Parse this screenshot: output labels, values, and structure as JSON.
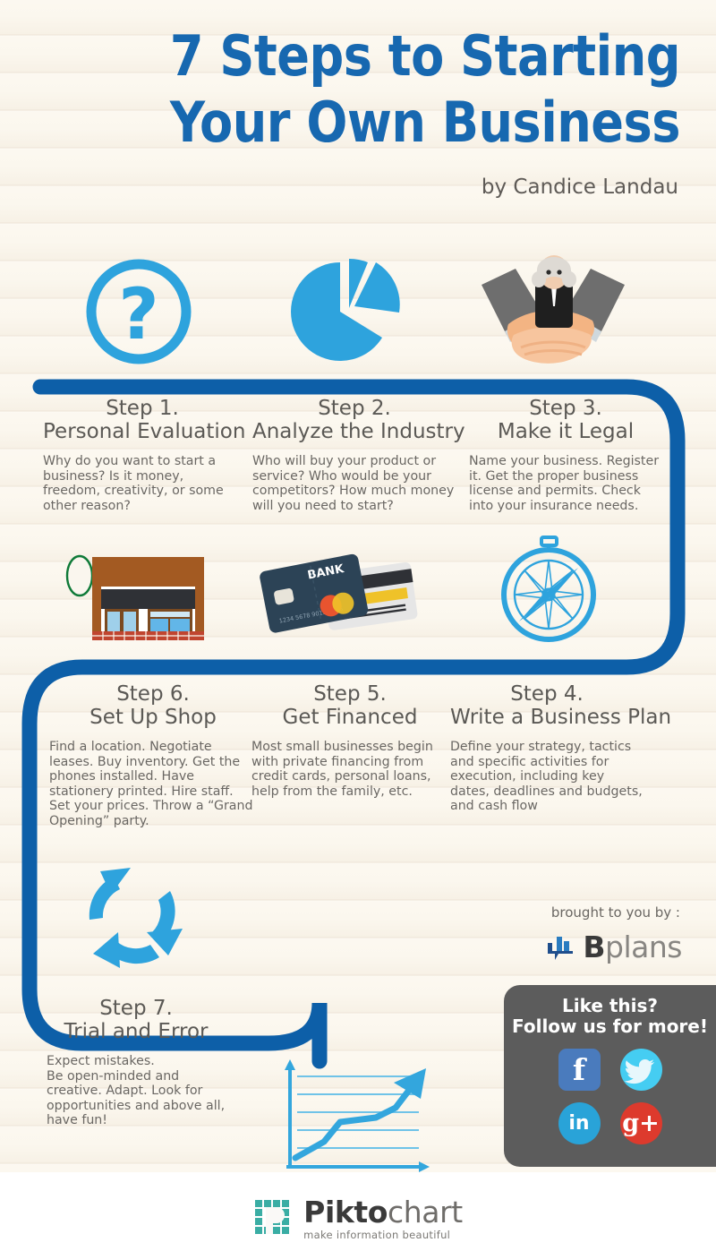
{
  "header": {
    "title_line1": "7 Steps to Starting",
    "title_line2": "Your Own Business",
    "byline": "by Candice Landau",
    "title_color": "#1768b0"
  },
  "theme": {
    "background": "#faf6ee",
    "ribbon_color": "#0d5fa8",
    "icon_blue": "#2ea3dd",
    "heading_gray": "#5b5955",
    "body_gray": "#6a6763"
  },
  "steps": [
    {
      "number": "Step 1.",
      "title": "Personal Evaluation",
      "body": "Why do you want to start a business? Is it money, freedom, creativity, or some other reason?",
      "icon": "question-mark-circle-icon"
    },
    {
      "number": "Step 2.",
      "title": "Analyze the Industry",
      "body": "Who will buy your product or service? Who would be your competitors? How much money will you need to start?",
      "icon": "pie-chart-icon"
    },
    {
      "number": "Step 3.",
      "title": "Make it Legal",
      "body": "Name your business. Register it. Get the proper business license and permits. Check into your insurance needs.",
      "icon": "judge-handshake-icon"
    },
    {
      "number": "Step 4.",
      "title": "Write a Business Plan",
      "body": "Define your strategy, tactics and specific activities for execution, including key dates, deadlines and budgets, and cash flow",
      "icon": "compass-icon"
    },
    {
      "number": "Step 5.",
      "title": "Get Financed",
      "body": "Most small businesses begin with private financing from credit cards, personal loans, help from the family, etc.",
      "icon": "credit-cards-icon"
    },
    {
      "number": "Step 6.",
      "title": "Set Up Shop",
      "body": "Find a location. Negotiate leases. Buy inventory. Get the phones installed. Have stationery printed. Hire staff. Set your prices. Throw a “Grand Opening” party.",
      "icon": "storefront-icon"
    },
    {
      "number": "Step 7.",
      "title": "Trial and Error",
      "body": "Expect mistakes.\nBe open-minded and creative.  Adapt.  Look for opportunities and above all, have fun!",
      "icon": "recycle-arrows-icon"
    }
  ],
  "sponsor": {
    "brought_label": "brought to you by :",
    "brand_bold": "B",
    "brand_rest": "plans",
    "logo_icon": "bplans-bar-chart-icon"
  },
  "social": {
    "line1": "Like this?",
    "line2": "Follow us for more!",
    "icons": [
      {
        "name": "facebook-icon",
        "glyph": "f",
        "color": "#4a7bbd"
      },
      {
        "name": "twitter-icon",
        "glyph": "",
        "color": "#45cdf2"
      },
      {
        "name": "linkedin-icon",
        "glyph": "in",
        "color": "#29a3d8"
      },
      {
        "name": "googleplus-icon",
        "glyph": "g+",
        "color": "#dd3a2d"
      }
    ]
  },
  "footer": {
    "brand_bold": "Pikto",
    "brand_rest": "chart",
    "tagline": "make information beautiful",
    "mark_color": "#3aada4"
  },
  "growth_chart": {
    "type": "line",
    "description": "upward trending growth arrow with 5 horizontal gridlines",
    "gridlines": 5
  },
  "credit_card": {
    "bank_label": "BANK",
    "card_number": "1234 5678 9012 3456"
  }
}
